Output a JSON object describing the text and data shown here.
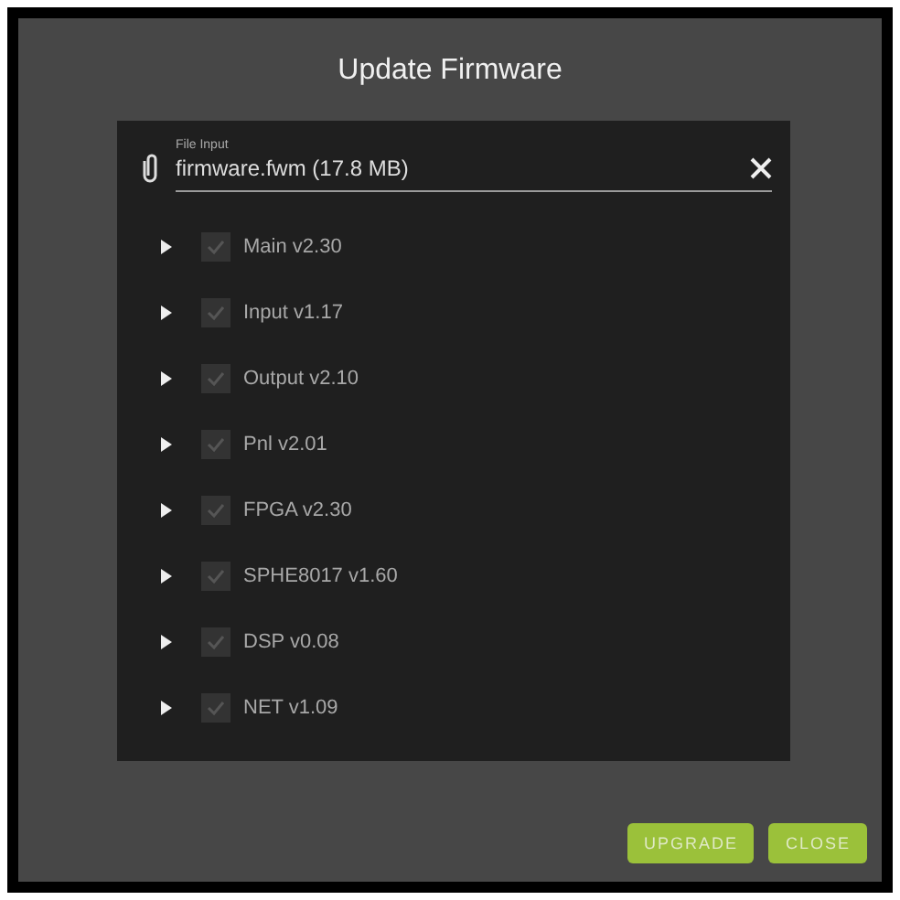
{
  "dialog": {
    "title": "Update Firmware"
  },
  "file_input": {
    "label": "File Input",
    "value": "firmware.fwm (17.8 MB)"
  },
  "modules": [
    {
      "label": "Main v2.30",
      "checked": true,
      "disabled": true,
      "expanded": false
    },
    {
      "label": "Input v1.17",
      "checked": true,
      "disabled": true,
      "expanded": false
    },
    {
      "label": "Output v2.10",
      "checked": true,
      "disabled": true,
      "expanded": false
    },
    {
      "label": "Pnl v2.01",
      "checked": true,
      "disabled": true,
      "expanded": false
    },
    {
      "label": "FPGA v2.30",
      "checked": true,
      "disabled": true,
      "expanded": false
    },
    {
      "label": "SPHE8017 v1.60",
      "checked": true,
      "disabled": true,
      "expanded": false
    },
    {
      "label": "DSP v0.08",
      "checked": true,
      "disabled": true,
      "expanded": false
    },
    {
      "label": "NET v1.09",
      "checked": true,
      "disabled": true,
      "expanded": false
    }
  ],
  "buttons": [
    "UPGRADE",
    "CLOSE"
  ]
}
